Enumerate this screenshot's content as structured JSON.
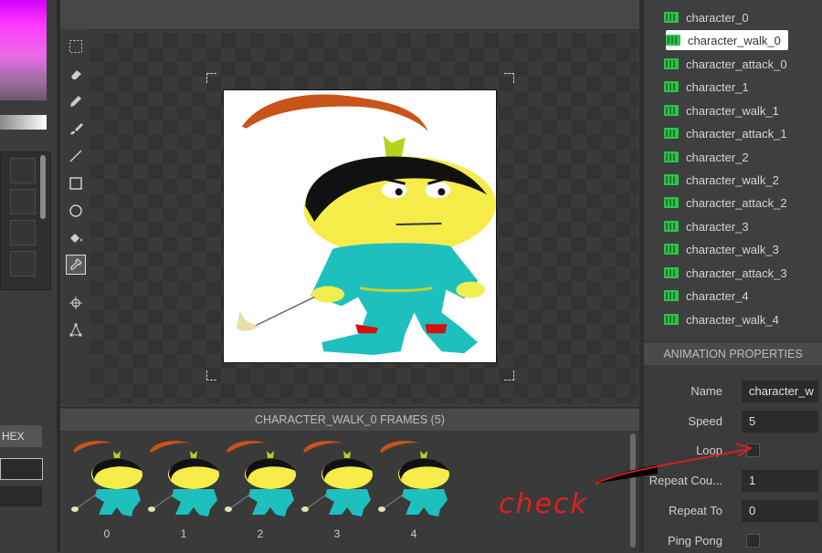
{
  "colors": {
    "accent_green": "#2ec24a",
    "annotation_red": "#e02020",
    "panel_bg": "#3c3c3c"
  },
  "left_panel": {
    "hex_label": "HEX"
  },
  "toolbar": {
    "tools": [
      "select-icon",
      "eraser-icon",
      "pencil-icon",
      "brush-icon",
      "line-icon",
      "rectangle-icon",
      "ellipse-icon",
      "fill-bucket-icon",
      "eyedropper-icon",
      "crosshair-icon",
      "node-tool-icon"
    ],
    "active_tool": "eyedropper-icon"
  },
  "frames": {
    "header": "CHARACTER_WALK_0 FRAMES (5)",
    "items": [
      "0",
      "1",
      "2",
      "3",
      "4"
    ]
  },
  "animations": {
    "selected": "character_walk_0",
    "items": [
      "character_0",
      "character_walk_0",
      "character_attack_0",
      "character_1",
      "character_walk_1",
      "character_attack_1",
      "character_2",
      "character_walk_2",
      "character_attack_2",
      "character_3",
      "character_walk_3",
      "character_attack_3",
      "character_4",
      "character_walk_4"
    ]
  },
  "properties": {
    "header": "ANIMATION PROPERTIES",
    "name_label": "Name",
    "name_value": "character_w",
    "speed_label": "Speed",
    "speed_value": "5",
    "loop_label": "Loop",
    "loop_checked": false,
    "repeat_count_label": "Repeat Cou...",
    "repeat_count_value": "1",
    "repeat_to_label": "Repeat To",
    "repeat_to_value": "0",
    "ping_pong_label": "Ping Pong",
    "ping_pong_checked": false
  },
  "annotation": {
    "text": "check"
  }
}
